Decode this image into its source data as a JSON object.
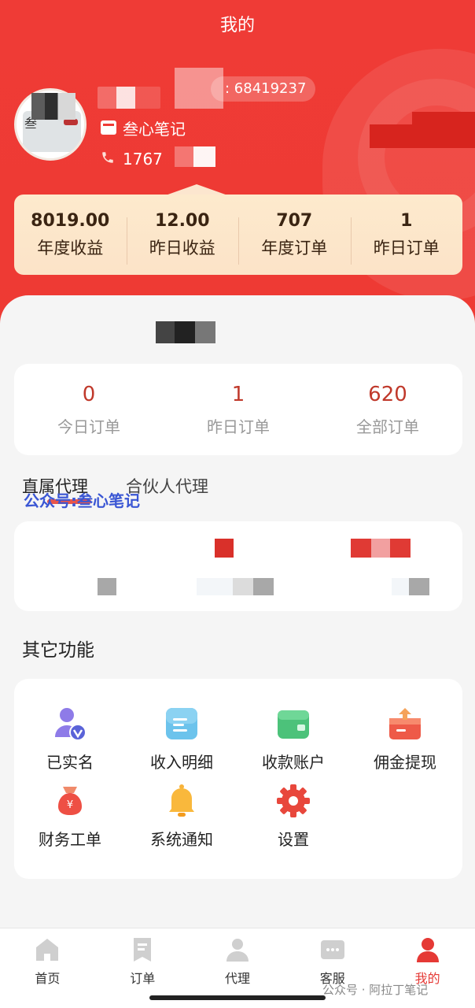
{
  "header": {
    "title": "我的",
    "id_suffix": ": 68419237",
    "shop_name": "叁心笔记",
    "phone_partial": "1767"
  },
  "stats": [
    {
      "value": "8019.00",
      "label": "年度收益"
    },
    {
      "value": "12.00",
      "label": "昨日收益"
    },
    {
      "value": "707",
      "label": "年度订单"
    },
    {
      "value": "1",
      "label": "昨日订单"
    }
  ],
  "orders": [
    {
      "value": "0",
      "label": "今日订单"
    },
    {
      "value": "1",
      "label": "昨日订单"
    },
    {
      "value": "620",
      "label": "全部订单"
    }
  ],
  "tabs": {
    "direct": "直属代理",
    "partner": "合伙人代理"
  },
  "watermark": "公众号:叁心笔记",
  "other": {
    "title": "其它功能",
    "items": [
      {
        "label": "已实名",
        "icon": "verified-user-icon"
      },
      {
        "label": "收入明细",
        "icon": "income-detail-icon"
      },
      {
        "label": "收款账户",
        "icon": "wallet-icon"
      },
      {
        "label": "佣金提现",
        "icon": "withdraw-box-icon"
      },
      {
        "label": "财务工单",
        "icon": "money-bag-icon"
      },
      {
        "label": "系统通知",
        "icon": "bell-icon"
      },
      {
        "label": "设置",
        "icon": "gear-icon"
      }
    ]
  },
  "nav": [
    {
      "label": "首页",
      "icon": "home-icon"
    },
    {
      "label": "订单",
      "icon": "order-icon"
    },
    {
      "label": "代理",
      "icon": "agent-icon"
    },
    {
      "label": "客服",
      "icon": "service-icon"
    },
    {
      "label": "我的",
      "icon": "profile-icon"
    }
  ],
  "footer_watermark": "公众号 · 阿拉丁笔记",
  "colors": {
    "brand_red": "#ef3b36",
    "stats_card": "#fce6cf",
    "accent_text": "#c0392b",
    "active_nav": "#e53935"
  }
}
